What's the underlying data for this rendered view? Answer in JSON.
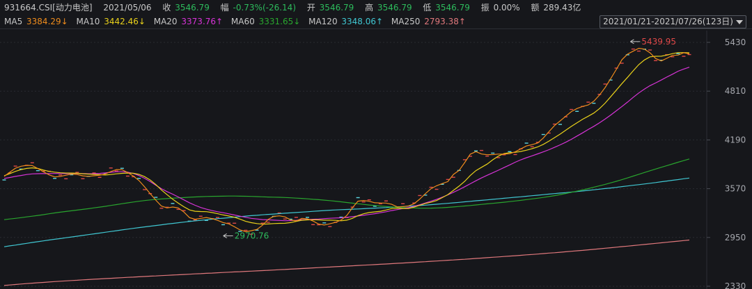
{
  "header": {
    "code": "931664.CSI[动力电池]",
    "date": "2021/05/06",
    "close_label": "收",
    "close": "3546.79",
    "change_label": "幅",
    "change": "-0.73%(-26.14)",
    "open_label": "开",
    "open": "3546.79",
    "high_label": "高",
    "high": "3546.79",
    "low_label": "低",
    "low": "3546.79",
    "amp_label": "振",
    "amp": "0.00%",
    "amount_label": "额",
    "amount": "289.43亿"
  },
  "ma_bar": {
    "items": [
      {
        "name": "MA5",
        "value": "3384.29↓",
        "color": "#ef8c1c"
      },
      {
        "name": "MA10",
        "value": "3442.46↓",
        "color": "#e9d11a"
      },
      {
        "name": "MA20",
        "value": "3373.76↑",
        "color": "#d733d7"
      },
      {
        "name": "MA60",
        "value": "3331.65↓",
        "color": "#29a52e"
      },
      {
        "name": "MA120",
        "value": "3348.06↑",
        "color": "#40c7d2"
      },
      {
        "name": "MA250",
        "value": "2793.38↑",
        "color": "#e0787c"
      }
    ],
    "range_label": "2021/01/21-2021/07/26(123日)"
  },
  "chart_data": {
    "type": "line",
    "points": 123,
    "ylim": [
      2330,
      5580
    ],
    "yticks": [
      "5430",
      "4810",
      "4190",
      "3570",
      "2950",
      "2330"
    ],
    "annotations": {
      "high": {
        "label": "5439.95",
        "index": 113,
        "value": 5439.95
      },
      "low": {
        "label": "2970.76",
        "index": 41,
        "value": 2970.76
      }
    },
    "candle_color": "#5bd7e2",
    "series": [
      {
        "name": "MA5",
        "color": "#ef8c1c",
        "values": [
          3726,
          3779,
          3830,
          3855,
          3867,
          3863,
          3826,
          3784,
          3746,
          3719,
          3726,
          3741,
          3756,
          3750,
          3733,
          3727,
          3734,
          3741,
          3757,
          3788,
          3813,
          3811,
          3775,
          3731,
          3673,
          3594,
          3507,
          3424,
          3349,
          3325,
          3337,
          3325,
          3273,
          3202,
          3181,
          3193,
          3203,
          3189,
          3167,
          3139,
          3123,
          3086,
          3045,
          3023,
          3036,
          3052,
          3105,
          3179,
          3218,
          3225,
          3211,
          3173,
          3160,
          3193,
          3187,
          3158,
          3120,
          3108,
          3124,
          3142,
          3172,
          3229,
          3327,
          3411,
          3420,
          3410,
          3391,
          3388,
          3387,
          3371,
          3339,
          3343,
          3351,
          3379,
          3438,
          3506,
          3570,
          3607,
          3635,
          3660,
          3751,
          3802,
          3902,
          4009,
          4041,
          4011,
          4002,
          4004,
          4010,
          4010,
          4014,
          4040,
          4076,
          4113,
          4130,
          4151,
          4214,
          4295,
          4373,
          4432,
          4492,
          4550,
          4589,
          4616,
          4634,
          4683,
          4760,
          4855,
          4969,
          5085,
          5210,
          5281,
          5318,
          5355,
          5344,
          5297,
          5225,
          5194,
          5228,
          5265,
          5268,
          5298,
          5284
        ]
      },
      {
        "name": "MA10",
        "color": "#e9d11a",
        "values": [
          3735,
          3762,
          3790,
          3812,
          3828,
          3835,
          3827,
          3807,
          3790,
          3780,
          3772,
          3769,
          3769,
          3766,
          3760,
          3755,
          3752,
          3748,
          3744,
          3750,
          3759,
          3765,
          3768,
          3766,
          3752,
          3724,
          3680,
          3622,
          3554,
          3494,
          3436,
          3386,
          3340,
          3300,
          3283,
          3279,
          3278,
          3267,
          3252,
          3236,
          3223,
          3207,
          3182,
          3155,
          3138,
          3127,
          3119,
          3121,
          3127,
          3129,
          3130,
          3139,
          3154,
          3169,
          3173,
          3175,
          3173,
          3170,
          3170,
          3167,
          3162,
          3170,
          3193,
          3227,
          3251,
          3267,
          3275,
          3283,
          3299,
          3317,
          3323,
          3318,
          3318,
          3336,
          3360,
          3382,
          3398,
          3419,
          3456,
          3495,
          3549,
          3603,
          3664,
          3738,
          3800,
          3842,
          3883,
          3937,
          3984,
          4016,
          4028,
          4032,
          4043,
          4059,
          4079,
          4101,
          4133,
          4175,
          4219,
          4264,
          4314,
          4362,
          4408,
          4453,
          4491,
          4532,
          4588,
          4657,
          4739,
          4822,
          4906,
          4986,
          5068,
          5147,
          5206,
          5246,
          5253,
          5254,
          5268,
          5287,
          5300,
          5300,
          5297
        ]
      },
      {
        "name": "MA20",
        "color": "#d733d7",
        "values": [
          3700,
          3712,
          3726,
          3738,
          3750,
          3758,
          3761,
          3762,
          3762,
          3763,
          3763,
          3762,
          3764,
          3763,
          3762,
          3760,
          3761,
          3764,
          3770,
          3778,
          3785,
          3785,
          3779,
          3763,
          3737,
          3702,
          3660,
          3614,
          3570,
          3533,
          3500,
          3465,
          3428,
          3391,
          3359,
          3331,
          3309,
          3292,
          3277,
          3264,
          3250,
          3235,
          3220,
          3206,
          3193,
          3185,
          3177,
          3174,
          3170,
          3166,
          3163,
          3165,
          3168,
          3173,
          3177,
          3181,
          3184,
          3189,
          3194,
          3197,
          3200,
          3206,
          3214,
          3223,
          3232,
          3242,
          3252,
          3264,
          3277,
          3292,
          3304,
          3317,
          3330,
          3346,
          3366,
          3388,
          3411,
          3435,
          3462,
          3491,
          3524,
          3558,
          3595,
          3633,
          3671,
          3707,
          3740,
          3772,
          3805,
          3838,
          3872,
          3906,
          3937,
          3964,
          3988,
          4012,
          4038,
          4065,
          4095,
          4127,
          4161,
          4198,
          4239,
          4280,
          4322,
          4363,
          4408,
          4455,
          4506,
          4560,
          4615,
          4671,
          4730,
          4787,
          4836,
          4880,
          4914,
          4951,
          4989,
          5025,
          5063,
          5091,
          5115
        ]
      },
      {
        "name": "MA60",
        "color": "#29a52e",
        "values": [
          3176,
          3185,
          3193,
          3202,
          3211,
          3220,
          3230,
          3240,
          3251,
          3262,
          3271,
          3280,
          3289,
          3298,
          3307,
          3316,
          3326,
          3336,
          3346,
          3357,
          3368,
          3379,
          3390,
          3400,
          3410,
          3419,
          3427,
          3434,
          3439,
          3444,
          3449,
          3453,
          3457,
          3461,
          3465,
          3468,
          3471,
          3473,
          3474,
          3475,
          3476,
          3476,
          3475,
          3474,
          3472,
          3469,
          3467,
          3464,
          3462,
          3460,
          3458,
          3454,
          3450,
          3446,
          3441,
          3435,
          3430,
          3424,
          3418,
          3411,
          3403,
          3394,
          3386,
          3378,
          3370,
          3362,
          3356,
          3349,
          3343,
          3338,
          3333,
          3330,
          3327,
          3325,
          3323,
          3322,
          3323,
          3325,
          3328,
          3332,
          3338,
          3344,
          3350,
          3356,
          3363,
          3370,
          3377,
          3384,
          3391,
          3398,
          3406,
          3414,
          3422,
          3431,
          3440,
          3449,
          3459,
          3470,
          3482,
          3495,
          3509,
          3524,
          3539,
          3555,
          3571,
          3589,
          3607,
          3625,
          3644,
          3664,
          3685,
          3707,
          3730,
          3753,
          3776,
          3798,
          3820,
          3842,
          3863,
          3884,
          3906,
          3927,
          3948
        ]
      },
      {
        "name": "MA120",
        "color": "#40c7d2",
        "values": [
          2832,
          2843,
          2853,
          2864,
          2875,
          2886,
          2896,
          2907,
          2917,
          2927,
          2936,
          2946,
          2956,
          2966,
          2976,
          2986,
          2996,
          3006,
          3016,
          3026,
          3036,
          3046,
          3056,
          3066,
          3075,
          3084,
          3093,
          3102,
          3111,
          3120,
          3128,
          3137,
          3145,
          3153,
          3161,
          3168,
          3175,
          3182,
          3189,
          3195,
          3201,
          3208,
          3215,
          3221,
          3227,
          3232,
          3238,
          3243,
          3248,
          3253,
          3258,
          3263,
          3267,
          3272,
          3277,
          3282,
          3287,
          3292,
          3296,
          3300,
          3303,
          3306,
          3309,
          3312,
          3316,
          3320,
          3323,
          3326,
          3330,
          3335,
          3339,
          3343,
          3347,
          3352,
          3356,
          3361,
          3367,
          3372,
          3378,
          3384,
          3390,
          3396,
          3403,
          3409,
          3416,
          3422,
          3428,
          3435,
          3441,
          3448,
          3454,
          3461,
          3467,
          3474,
          3481,
          3487,
          3494,
          3501,
          3507,
          3514,
          3520,
          3527,
          3534,
          3541,
          3549,
          3556,
          3564,
          3572,
          3579,
          3587,
          3596,
          3604,
          3613,
          3621,
          3630,
          3639,
          3648,
          3658,
          3667,
          3677,
          3686,
          3696,
          3705
        ]
      },
      {
        "name": "MA250",
        "color": "#e0787c",
        "values": [
          2340,
          2346,
          2352,
          2358,
          2364,
          2369,
          2374,
          2379,
          2384,
          2389,
          2394,
          2398,
          2402,
          2406,
          2411,
          2415,
          2419,
          2423,
          2427,
          2431,
          2435,
          2439,
          2443,
          2446,
          2450,
          2454,
          2458,
          2461,
          2465,
          2469,
          2472,
          2476,
          2479,
          2483,
          2487,
          2490,
          2494,
          2497,
          2501,
          2505,
          2508,
          2512,
          2515,
          2519,
          2522,
          2525,
          2529,
          2532,
          2536,
          2540,
          2543,
          2547,
          2551,
          2555,
          2559,
          2563,
          2567,
          2571,
          2574,
          2578,
          2582,
          2586,
          2590,
          2594,
          2598,
          2601,
          2605,
          2609,
          2613,
          2617,
          2621,
          2625,
          2629,
          2634,
          2638,
          2642,
          2647,
          2651,
          2655,
          2660,
          2664,
          2669,
          2673,
          2678,
          2683,
          2688,
          2693,
          2698,
          2703,
          2708,
          2713,
          2718,
          2723,
          2729,
          2734,
          2739,
          2745,
          2751,
          2756,
          2762,
          2768,
          2774,
          2780,
          2786,
          2793,
          2799,
          2806,
          2813,
          2819,
          2826,
          2833,
          2840,
          2847,
          2854,
          2861,
          2868,
          2875,
          2882,
          2889,
          2896,
          2903,
          2910,
          2917
        ]
      }
    ]
  }
}
